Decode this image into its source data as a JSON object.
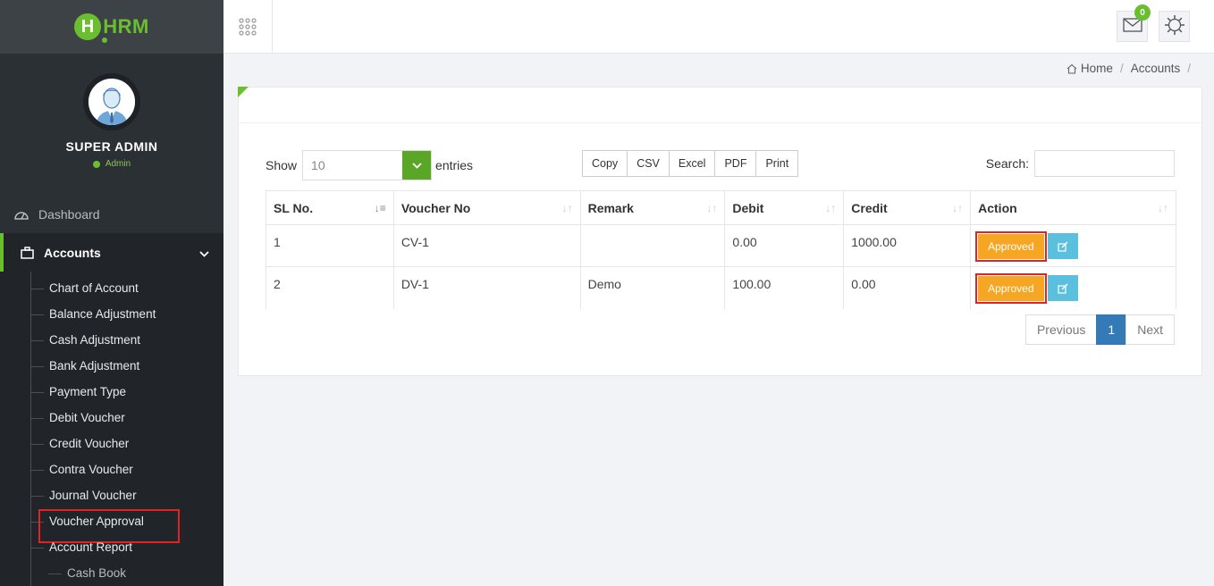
{
  "app": {
    "logo_letter": "H",
    "logo_text": "HRM"
  },
  "profile": {
    "name": "SUPER ADMIN",
    "role": "Admin"
  },
  "nav": {
    "dashboard": "Dashboard",
    "accounts": "Accounts",
    "submenu": [
      "Chart of Account",
      "Balance Adjustment",
      "Cash Adjustment",
      "Bank Adjustment",
      "Payment Type",
      "Debit Voucher",
      "Credit Voucher",
      "Contra Voucher",
      "Journal Voucher",
      "Voucher Approval",
      "Account Report"
    ],
    "subsubmenu": [
      "Cash Book"
    ]
  },
  "topbar": {
    "mail_count": "0"
  },
  "breadcrumb": {
    "home": "Home",
    "current": "Accounts",
    "sep": "/"
  },
  "table_controls": {
    "show_label": "Show",
    "entries_value": "10",
    "entries_label": "entries",
    "buttons": [
      "Copy",
      "CSV",
      "Excel",
      "PDF",
      "Print"
    ],
    "search_label": "Search:"
  },
  "table": {
    "columns": [
      "SL No.",
      "Voucher No",
      "Remark",
      "Debit",
      "Credit",
      "Action"
    ],
    "rows": [
      {
        "sl": "1",
        "voucher": "CV-1",
        "remark": "",
        "debit": "0.00",
        "credit": "1000.00",
        "status": "Approved"
      },
      {
        "sl": "2",
        "voucher": "DV-1",
        "remark": "Demo",
        "debit": "100.00",
        "credit": "0.00",
        "status": "Approved"
      }
    ]
  },
  "pagination": {
    "previous": "Previous",
    "page": "1",
    "next": "Next"
  },
  "colors": {
    "brand_green": "#6abf2e",
    "sidebar_bg": "#2b3035",
    "approved": "#f5a623",
    "edit": "#5bc0de",
    "page_active": "#337ab7"
  }
}
